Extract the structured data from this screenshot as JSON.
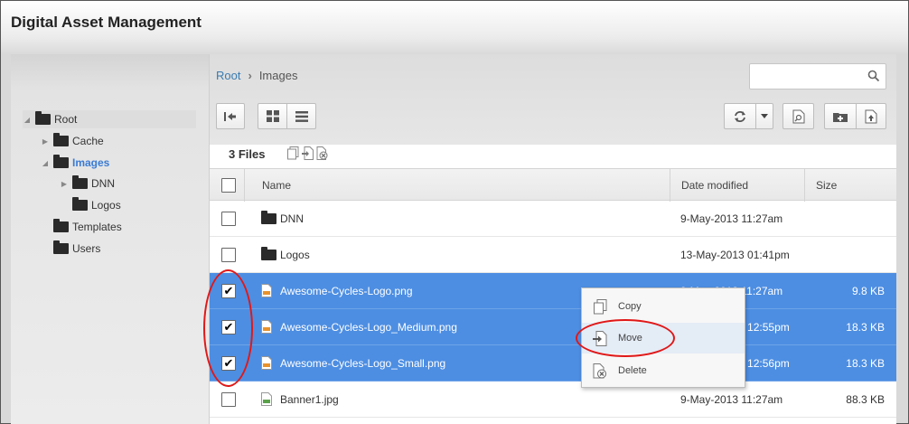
{
  "app": {
    "title": "Digital Asset Management"
  },
  "tree": [
    {
      "label": "Root",
      "toggle": "◢",
      "level": 0
    },
    {
      "label": "Cache",
      "toggle": "▶",
      "level": 1
    },
    {
      "label": "Images",
      "toggle": "◢",
      "level": 1,
      "active": true
    },
    {
      "label": "DNN",
      "toggle": "▶",
      "level": 2
    },
    {
      "label": "Logos",
      "toggle": "",
      "level": 2
    },
    {
      "label": "Templates",
      "toggle": "",
      "level": 1
    },
    {
      "label": "Users",
      "toggle": "",
      "level": 1
    }
  ],
  "breadcrumb": {
    "root": "Root",
    "separator": "›",
    "current": "Images"
  },
  "search": {
    "placeholder": ""
  },
  "files_bar": {
    "count_label": "3 Files"
  },
  "table": {
    "headers": {
      "name": "Name",
      "date": "Date modified",
      "size": "Size"
    },
    "rows": [
      {
        "name": "DNN",
        "type": "folder",
        "date": "9-May-2013 11:27am",
        "size": "",
        "checked": false,
        "selected": false
      },
      {
        "name": "Logos",
        "type": "folder",
        "date": "13-May-2013 01:41pm",
        "size": "",
        "checked": false,
        "selected": false
      },
      {
        "name": "Awesome-Cycles-Logo.png",
        "type": "png",
        "date": "9-May-2013 11:27am",
        "size": "9.8 KB",
        "checked": true,
        "selected": true
      },
      {
        "name": "Awesome-Cycles-Logo_Medium.png",
        "type": "png",
        "date": "13-May-2013 12:55pm",
        "size": "18.3 KB",
        "checked": true,
        "selected": true
      },
      {
        "name": "Awesome-Cycles-Logo_Small.png",
        "type": "png",
        "date": "13-May-2013 12:56pm",
        "size": "18.3 KB",
        "checked": true,
        "selected": true
      },
      {
        "name": "Banner1.jpg",
        "type": "jpg",
        "date": "9-May-2013 11:27am",
        "size": "88.3 KB",
        "checked": false,
        "selected": false
      }
    ]
  },
  "context_menu": {
    "items": [
      {
        "label": "Copy",
        "icon": "copy-icon"
      },
      {
        "label": "Move",
        "icon": "move-icon"
      },
      {
        "label": "Delete",
        "icon": "delete-icon"
      }
    ]
  },
  "colors": {
    "selection": "#4d8ee2",
    "link": "#3a7bb0",
    "active_tree": "#3a7bd5",
    "annotation": "#e01818"
  }
}
